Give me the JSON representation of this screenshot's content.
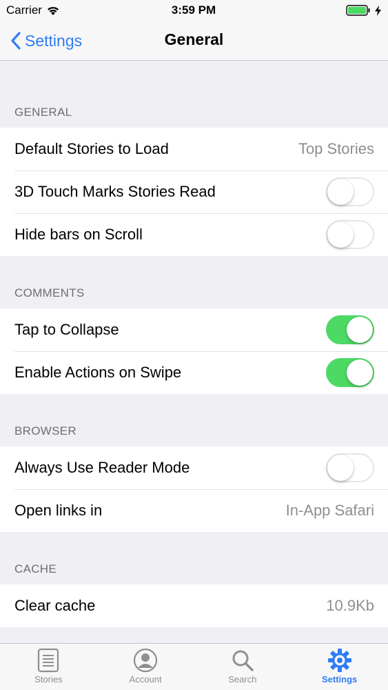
{
  "status_bar": {
    "carrier": "Carrier",
    "time": "3:59 PM"
  },
  "nav": {
    "back_label": "Settings",
    "title": "General"
  },
  "sections": [
    {
      "header": "GENERAL",
      "rows": [
        {
          "label": "Default Stories to Load",
          "value": "Top Stories"
        },
        {
          "label": "3D Touch Marks Stories Read",
          "toggle": false
        },
        {
          "label": "Hide bars on Scroll",
          "toggle": false
        }
      ]
    },
    {
      "header": "COMMENTS",
      "rows": [
        {
          "label": "Tap to Collapse",
          "toggle": true
        },
        {
          "label": "Enable Actions on Swipe",
          "toggle": true
        }
      ]
    },
    {
      "header": "BROWSER",
      "rows": [
        {
          "label": "Always Use Reader Mode",
          "toggle": false
        },
        {
          "label": "Open links in",
          "value": "In-App Safari"
        }
      ]
    },
    {
      "header": "CACHE",
      "rows": [
        {
          "label": "Clear cache",
          "value": "10.9Kb"
        }
      ]
    }
  ],
  "tabs": [
    {
      "label": "Stories",
      "icon": "stories-icon",
      "active": false
    },
    {
      "label": "Account",
      "icon": "account-icon",
      "active": false
    },
    {
      "label": "Search",
      "icon": "search-icon",
      "active": false
    },
    {
      "label": "Settings",
      "icon": "settings-icon",
      "active": true
    }
  ],
  "colors": {
    "accent": "#2f7cf6",
    "switch_on": "#4cd964",
    "battery": "#4cd964"
  }
}
